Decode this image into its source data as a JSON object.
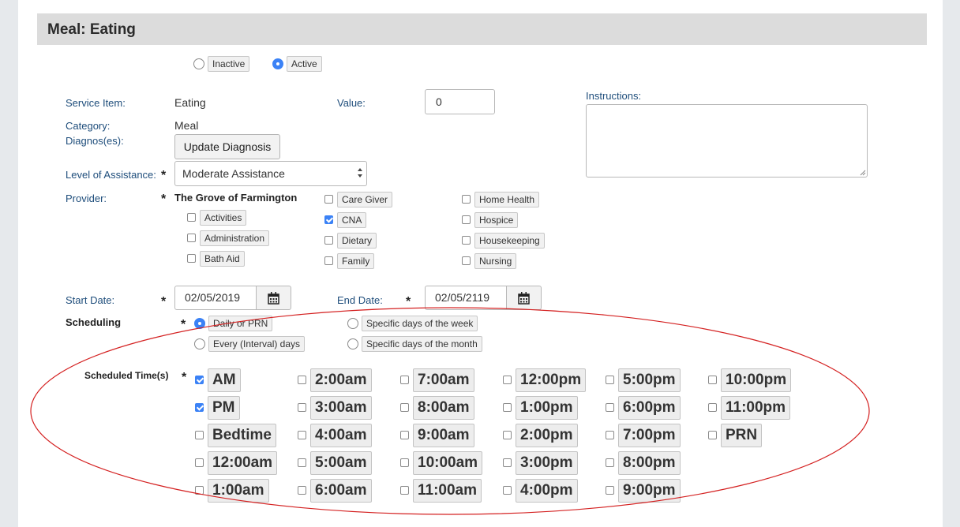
{
  "section": {
    "title": "Meal: Eating"
  },
  "status": {
    "inactive_label": "Inactive",
    "active_label": "Active",
    "selected": "Active"
  },
  "fields": {
    "service_item_label": "Service Item:",
    "service_item_value": "Eating",
    "category_label": "Category:",
    "category_value": "Meal",
    "diagnoses_label": "Diagnos(es):",
    "update_diagnosis_label": "Update Diagnosis",
    "value_label": "Value:",
    "value_value": "0",
    "instructions_label": "Instructions:",
    "instructions_value": "",
    "level_label": "Level of Assistance:",
    "level_value": "Moderate Assistance",
    "provider_label": "Provider:",
    "provider_value": "The Grove of Farmington",
    "start_date_label": "Start Date:",
    "start_date_value": "02/05/2019",
    "end_date_label": "End Date:",
    "end_date_value": "02/05/2119",
    "scheduling_label": "Scheduling",
    "scheduled_times_label": "Scheduled Time(s)"
  },
  "required_marker": "*",
  "providers": [
    {
      "label": "Activities",
      "checked": false
    },
    {
      "label": "Administration",
      "checked": false
    },
    {
      "label": "Bath Aid",
      "checked": false
    },
    {
      "label": "Care Giver",
      "checked": false
    },
    {
      "label": "CNA",
      "checked": true
    },
    {
      "label": "Dietary",
      "checked": false
    },
    {
      "label": "Family",
      "checked": false
    },
    {
      "label": "Home Health",
      "checked": false
    },
    {
      "label": "Hospice",
      "checked": false
    },
    {
      "label": "Housekeeping",
      "checked": false
    },
    {
      "label": "Nursing",
      "checked": false
    }
  ],
  "scheduling_options": [
    {
      "label": "Daily or PRN",
      "selected": true
    },
    {
      "label": "Every (Interval) days",
      "selected": false
    },
    {
      "label": "Specific days of the week",
      "selected": false
    },
    {
      "label": "Specific days of the month",
      "selected": false
    }
  ],
  "scheduled_times": [
    {
      "label": "AM",
      "checked": true
    },
    {
      "label": "PM",
      "checked": true
    },
    {
      "label": "Bedtime",
      "checked": false
    },
    {
      "label": "12:00am",
      "checked": false
    },
    {
      "label": "1:00am",
      "checked": false
    },
    {
      "label": "2:00am",
      "checked": false
    },
    {
      "label": "3:00am",
      "checked": false
    },
    {
      "label": "4:00am",
      "checked": false
    },
    {
      "label": "5:00am",
      "checked": false
    },
    {
      "label": "6:00am",
      "checked": false
    },
    {
      "label": "7:00am",
      "checked": false
    },
    {
      "label": "8:00am",
      "checked": false
    },
    {
      "label": "9:00am",
      "checked": false
    },
    {
      "label": "10:00am",
      "checked": false
    },
    {
      "label": "11:00am",
      "checked": false
    },
    {
      "label": "12:00pm",
      "checked": false
    },
    {
      "label": "1:00pm",
      "checked": false
    },
    {
      "label": "2:00pm",
      "checked": false
    },
    {
      "label": "3:00pm",
      "checked": false
    },
    {
      "label": "4:00pm",
      "checked": false
    },
    {
      "label": "5:00pm",
      "checked": false
    },
    {
      "label": "6:00pm",
      "checked": false
    },
    {
      "label": "7:00pm",
      "checked": false
    },
    {
      "label": "8:00pm",
      "checked": false
    },
    {
      "label": "9:00pm",
      "checked": false
    },
    {
      "label": "10:00pm",
      "checked": false
    },
    {
      "label": "11:00pm",
      "checked": false
    },
    {
      "label": "PRN",
      "checked": false
    }
  ],
  "colors": {
    "accent": "#3b82f6",
    "label": "#1e4d7b",
    "annotation": "#d42020",
    "header_bg": "#dcdcdc",
    "page_bg": "#e6e9ec"
  },
  "icons": {
    "calendar": "calendar-icon",
    "select_arrows": "select-arrows-icon"
  }
}
